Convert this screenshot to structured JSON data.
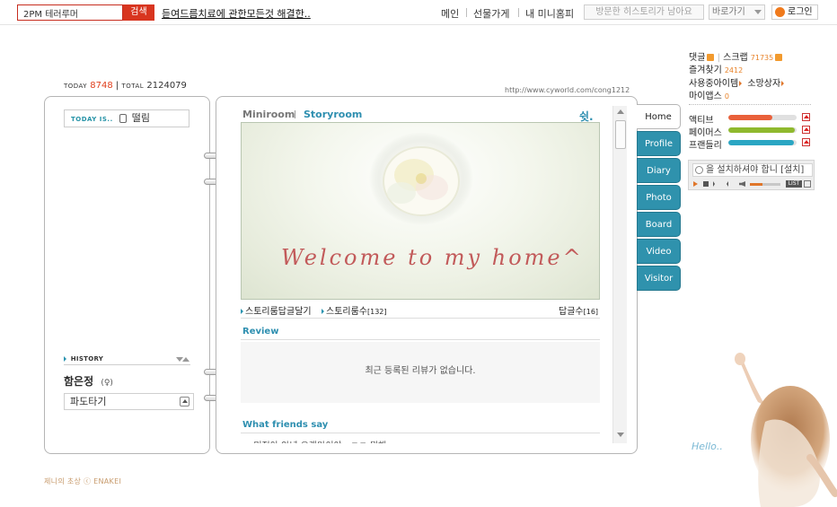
{
  "topbar": {
    "search_value": "2PM 테러루머",
    "search_button": "검색",
    "promo_link": "듣여드름치료에 관한모든것 해결한..",
    "menu_main": "메인",
    "menu_gift": "선물가게",
    "menu_mini": "내 미니홈피",
    "history_box": "방문한 히스토리가 남아요",
    "shortcut": "바로가기",
    "login": "로그인"
  },
  "counter": {
    "today_label": "TODAY",
    "today_value": "8748",
    "total_label": "TOTAL",
    "total_value": "2124079"
  },
  "url": "http://www.cyworld.com/cong1212",
  "left": {
    "today_is_label": "TODAY IS..",
    "mood": "떨림",
    "history_label": "HISTORY",
    "owner_name": "함은정",
    "owner_gender": "(♀)",
    "owner_select": "파도타기"
  },
  "main": {
    "tab_miniroom": "Miniroom",
    "tab_storyroom": "Storyroom",
    "room_title": "쉿.",
    "welcome_text": "Welcome to my home^",
    "story_reply_link": "스토리룸답글달기",
    "story_count_label": "스토리룸수",
    "story_count": "[132]",
    "reply_count_label": "답글수",
    "reply_count": "[16]",
    "review_title": "Review",
    "review_empty": "최근 등록된 리뷰가 없습니다.",
    "friends_title": "What friends say",
    "friends_cut": "· 민정아 안녕 오랜만이야 ..ㅋㅋ 뭐해 ..."
  },
  "side_tabs": [
    "Home",
    "Profile",
    "Diary",
    "Photo",
    "Board",
    "Video",
    "Visitor"
  ],
  "right": {
    "comment": "댓글",
    "scrap": "스크랩",
    "scrap_count": "71735",
    "favorites": "즐겨찾기",
    "favorites_count": "2412",
    "item_use": "사용중아이템",
    "wish_box": "소망상자",
    "my_apps": "마이앱스",
    "my_apps_count": "0",
    "stats": [
      {
        "label": "액티브",
        "level": 0.65,
        "color": "#e9603a"
      },
      {
        "label": "페이머스",
        "level": 0.97,
        "color": "#8fb92e"
      },
      {
        "label": "프랜들리",
        "level": 0.96,
        "color": "#2aa6c3"
      }
    ],
    "player_text": "을 설치하셔야 합니 [설치]",
    "player_list": "LIST"
  },
  "footer_credit": "제니의 초상 ⓒ ENAKEI",
  "hello": "Hello.."
}
